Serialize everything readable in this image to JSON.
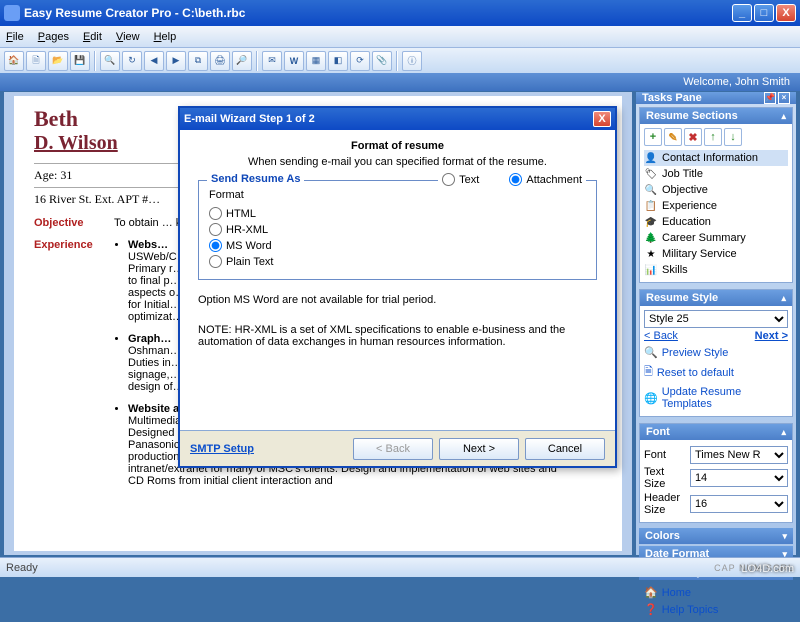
{
  "window": {
    "title": "Easy Resume Creator Pro - C:\\beth.rbc",
    "min": "_",
    "max": "□",
    "close": "X"
  },
  "menu": {
    "file": "File",
    "pages": "Pages",
    "edit": "Edit",
    "view": "View",
    "help": "Help"
  },
  "welcome": "Welcome, John Smith",
  "tasks_pane_title": "Tasks Pane",
  "resume_sections": {
    "title": "Resume Sections",
    "items": [
      "Contact Information",
      "Job Title",
      "Objective",
      "Experience",
      "Education",
      "Career Summary",
      "Military Service",
      "Skills"
    ]
  },
  "resume_style": {
    "title": "Resume Style",
    "selected": "Style 25",
    "back": "< Back",
    "next": "Next >",
    "preview": "Preview Style",
    "reset": "Reset to default",
    "update": "Update Resume Templates"
  },
  "font_panel": {
    "title": "Font",
    "font_label": "Font",
    "font_value": "Times New R",
    "text_size_label": "Text Size",
    "text_size_value": "14",
    "header_size_label": "Header Size",
    "header_size_value": "16"
  },
  "panels": {
    "colors": "Colors",
    "date_format": "Date Format",
    "header_style": "Header Style"
  },
  "home_link": "Home",
  "help_link": "Help Topics",
  "status": {
    "ready": "Ready",
    "caps": "CAP NUM SCRL"
  },
  "doc": {
    "first": "Beth",
    "last": "D. Wilson",
    "age": "Age: 31",
    "addr": "16 River St. Ext. APT #…",
    "objective_label": "Objective",
    "objective_text": "To obtain … knowledg…",
    "experience_label": "Experience",
    "job1_title": "Webs…",
    "job1_body": "USWeb/C…\nPrimary r…\nto final p…\naspects o…\nfor Initial…\noptimizat…",
    "job2_title": "Graph…",
    "job2_body": "Oshman…\nDuties in…\nsignage,…\ndesign of…",
    "job3_title": "Website and CD-Rom Designer",
    "job3_meta": "Multimedia Solution Corp, Edgewater, NJ, March 2001 - June 2002",
    "job3_body": "Designed and developed websites and CD-Roms for clients such as Choice Hotels, Panasonic, Rutgers University, and etc. Responsible for designing user interface and production of art for various multimedia CD-ROM products. Maintained the intranet/extranet for many of MSC's clients. Design and implementation of web sites and CD Roms from initial client interaction and"
  },
  "dialog": {
    "title": "E-mail Wizard Step 1 of 2",
    "heading": "Format of resume",
    "sub": "When sending e-mail you can specified format of the resume.",
    "legend": "Send Resume As",
    "opt_text": "Text",
    "opt_attachment": "Attachment",
    "format_label": "Format",
    "fmt_html": "HTML",
    "fmt_hrxml": "HR-XML",
    "fmt_word": "MS Word",
    "fmt_plain": "Plain Text",
    "trial_note": "Option MS Word are not available for trial period.",
    "hrxml_note": "NOTE: HR-XML is a set of XML specifications to enable e-business and the automation of data exchanges in human resources information.",
    "smtp": "SMTP Setup",
    "btn_back": "< Back",
    "btn_next": "Next >",
    "btn_cancel": "Cancel"
  },
  "watermark": "LO4D.com"
}
